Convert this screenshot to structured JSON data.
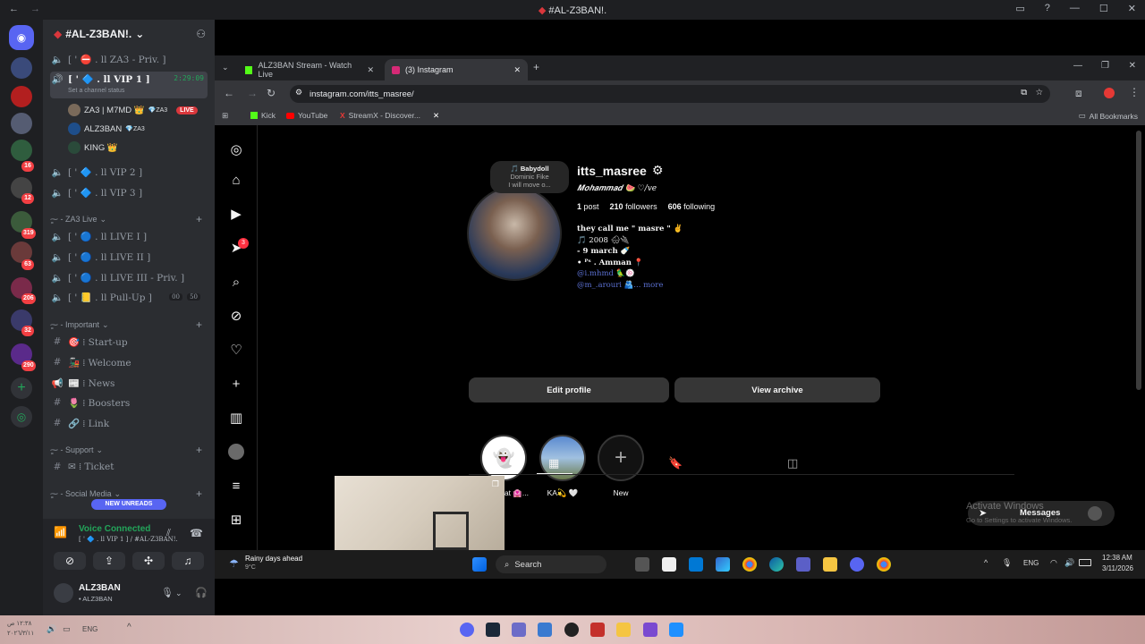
{
  "titlebar": {
    "title": "#AL-Z3BAN!."
  },
  "discord": {
    "server_badges": [
      "16",
      "12",
      "319",
      "63",
      "206",
      "32",
      "290"
    ],
    "guild_name": "#AL-Z3BAN!.",
    "channels": [
      {
        "icon": "speaker",
        "label": "[ ' ⛔ . ll ZA3 - Priv. ]"
      },
      {
        "icon": "speaker",
        "label": "[ ' 🔷 . ll VIP 1 ]",
        "time": "2:29:09",
        "status": "Set a channel status"
      },
      {
        "icon": "speaker",
        "label": "[ ' 🔷 . ll VIP 2 ]"
      },
      {
        "icon": "speaker",
        "label": "[ ' 🔷 . ll VIP 3 ]"
      },
      {
        "icon": "speaker",
        "label": "[ ' 🔵 . ll LIVE I ]"
      },
      {
        "icon": "speaker",
        "label": "[ ' 🔵 . ll LIVE II ]"
      },
      {
        "icon": "speaker",
        "label": "[ ' 🔵 . ll LIVE III - Priv. ]"
      },
      {
        "icon": "speaker",
        "label": "[ ' 📒 . ll Pull-Up ]",
        "counts": [
          "00",
          "50"
        ]
      },
      {
        "icon": "#",
        "label": "🎯 ⁞ Start-up"
      },
      {
        "icon": "#",
        "label": "🚂 ⁞ Welcome"
      },
      {
        "icon": "megaphone",
        "label": "📰 ⁞ News"
      },
      {
        "icon": "#",
        "label": "🌷 ⁞ Boosters"
      },
      {
        "icon": "#",
        "label": "🔗 ⁞ Link"
      },
      {
        "icon": "#",
        "label": "✉ ⁞ Ticket"
      }
    ],
    "categories": [
      "ٍ⁓ ‑ ZA3 Live",
      "ٍ⁓ ‑ Important",
      "ٍ⁓ ‑ Support",
      "ٍ⁓ ‑ Social Media"
    ],
    "voice_users": [
      {
        "name": "ZA3 | M7MD 👑",
        "tag": "💎ZA3",
        "live": "LIVE"
      },
      {
        "name": "ALZ3BAN",
        "tag": "💎ZA3"
      },
      {
        "name": "KING 👑"
      }
    ],
    "new_unreads": "NEW UNREADS",
    "voice": {
      "status": "Voice Connected",
      "channel": "[ ' 🔷 . ll VIP 1 ] / #AL-Z3BAN!."
    },
    "user": {
      "name": "ALZ3BAN",
      "status": "• ALZ3BAN"
    }
  },
  "browser": {
    "tabs": [
      {
        "label": "ALZ3BAN Stream - Watch Live",
        "color": "#53fc18"
      },
      {
        "label": "(3) Instagram",
        "color": "#d62976"
      }
    ],
    "url": "instagram.com/itts_masree/",
    "bookmarks": [
      "Kick",
      "YouTube",
      "StreamX - Discover..."
    ],
    "all_bookmarks": "All Bookmarks"
  },
  "instagram": {
    "note": {
      "title": "🎵 Babydoll",
      "artist": "Dominic Fike",
      "text": "I will move o..."
    },
    "username": "itts_masree",
    "display_name": "𝑴𝒐𝒉𝒂𝒎𝒎𝒂𝒅 🍉 ♡/ve",
    "stats": {
      "posts": "1",
      "posts_label": "post",
      "followers": "210",
      "followers_label": "followers",
      "following": "606",
      "following_label": "following"
    },
    "bio": [
      "they call me \" masre \" ✌",
      "🎵 2008 🌨🔌",
      "- 9 march 🍼",
      "• ᴾˢ . Amman 📍",
      "@i.mhmd 🦜🍥",
      "@m_.arouri 🫂... more"
    ],
    "buttons": {
      "edit": "Edit profile",
      "archive": "View archive"
    },
    "highlights": [
      "Snapchat 🏩...",
      "KA💫 🤍",
      "New"
    ],
    "notification_count": "3",
    "messages": "Messages",
    "activate": [
      "Activate Windows",
      "Go to Settings to activate Windows."
    ]
  },
  "taskbar": {
    "weather": "Rainy days ahead",
    "temp": "9°C",
    "search": "Search",
    "lang": "ENG",
    "time": "12:38 AM",
    "date": "3/11/2026"
  },
  "bottombar": {
    "time": "١٢:٣٨ ص",
    "date": "٢٠٢٦/٣/١١",
    "lang": "ENG"
  }
}
